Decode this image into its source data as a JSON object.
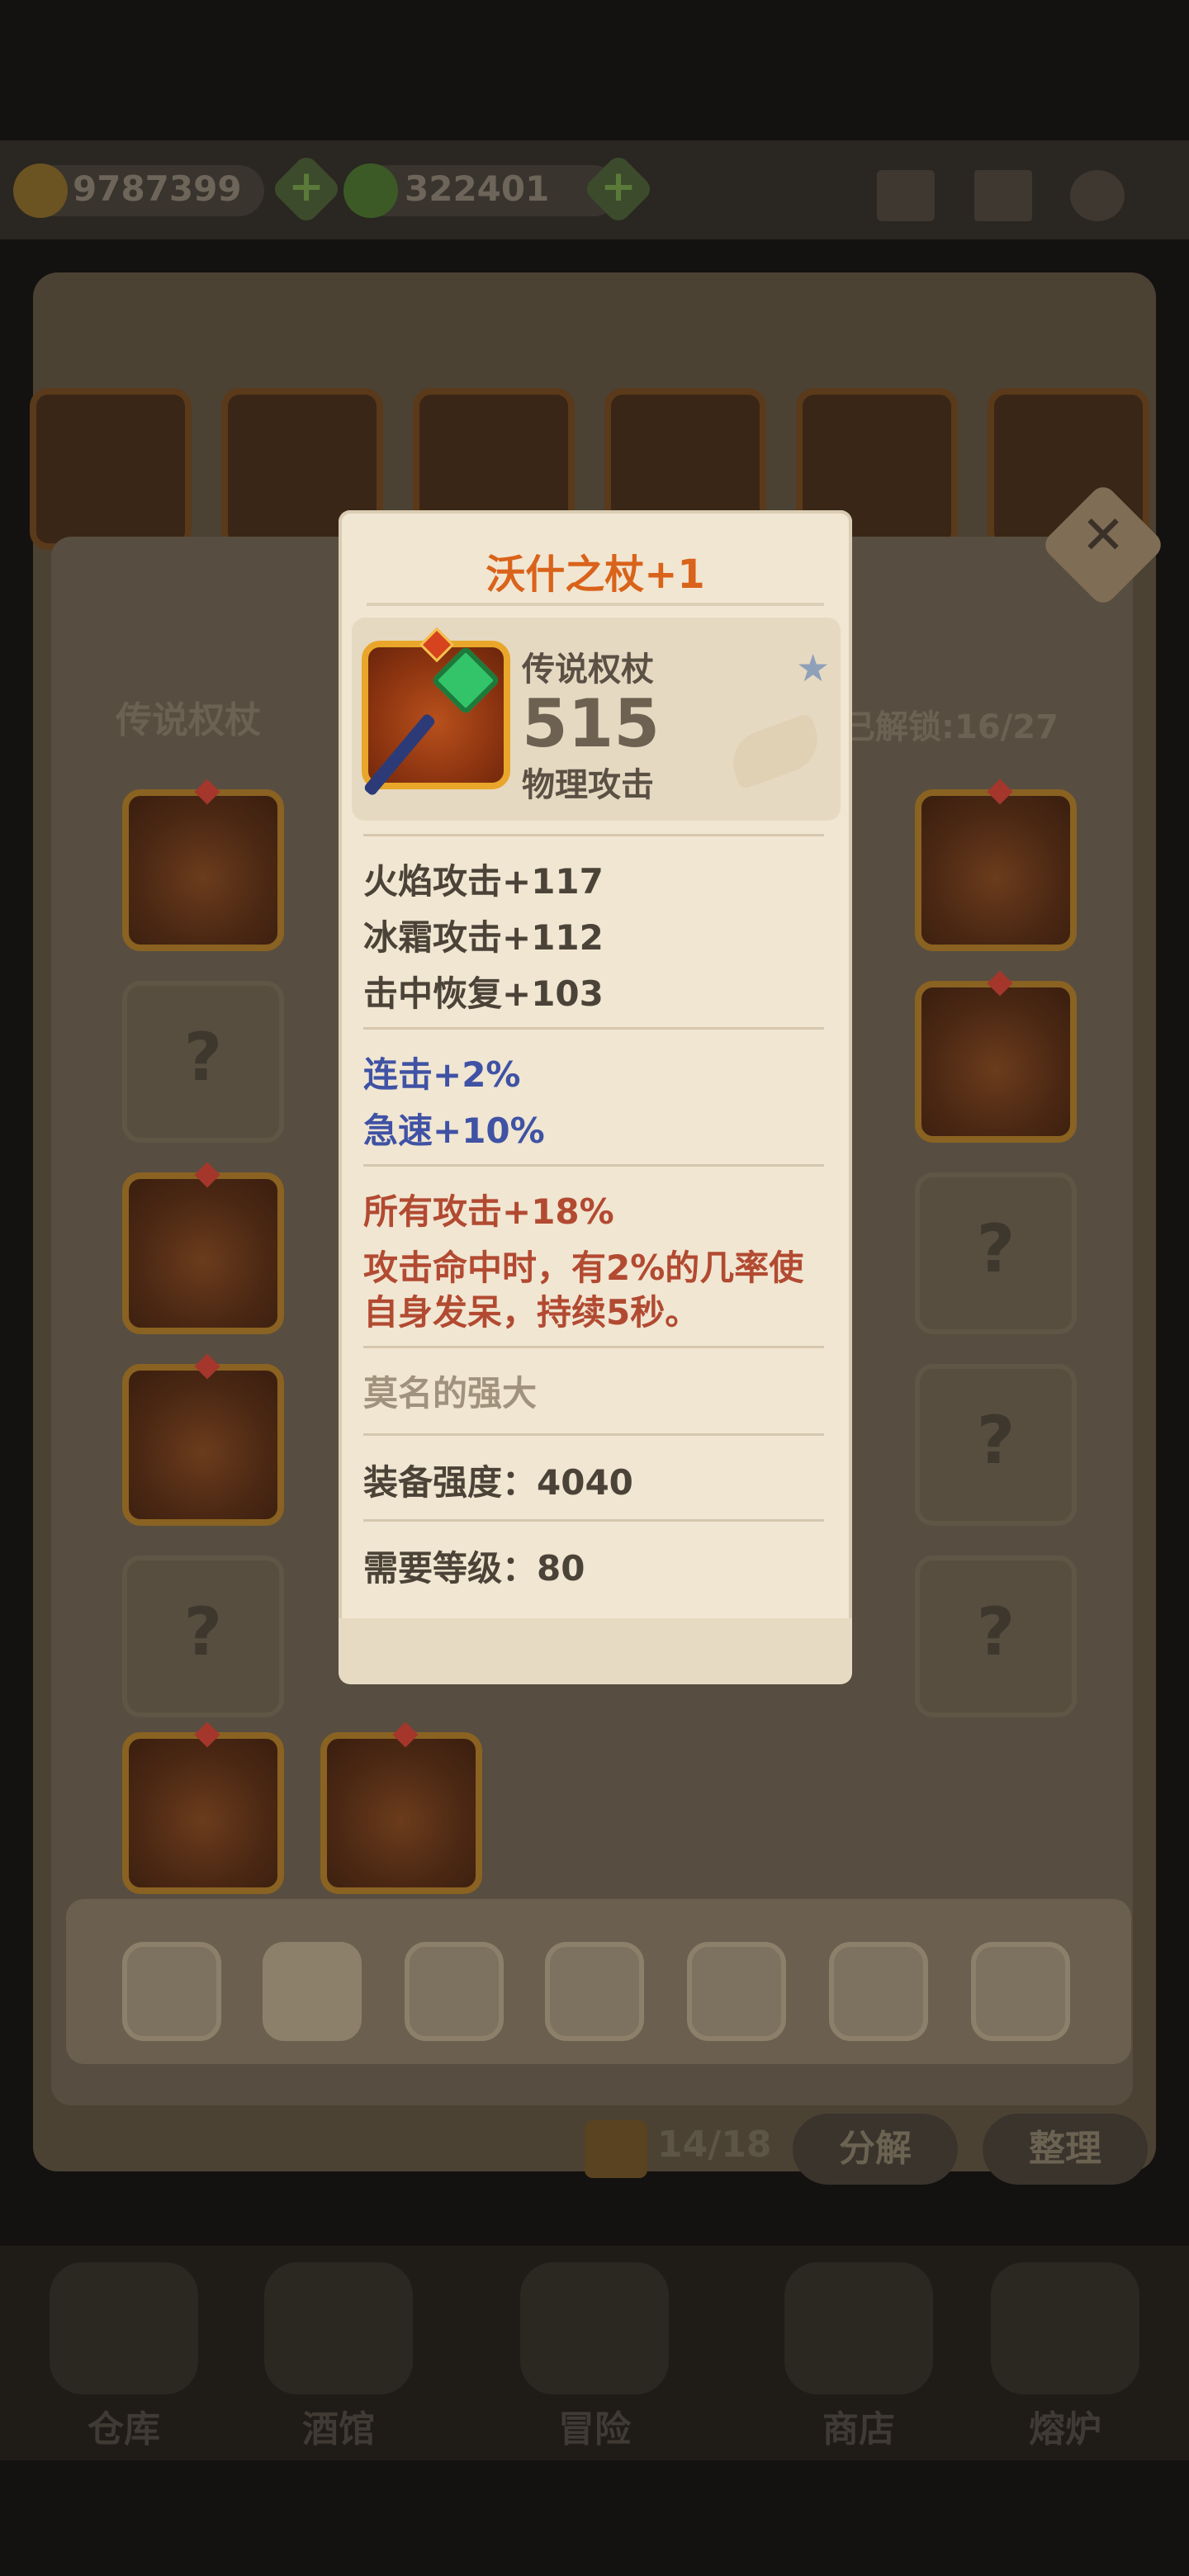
{
  "resources": {
    "gold": "9787399",
    "leaves": "322401"
  },
  "colors": {
    "legendary_name": "#d9631a",
    "blue_stat": "#3f52a4",
    "red_stat": "#b24a32",
    "muted": "#a0927c"
  },
  "panel": {
    "section_title": "传说权杖",
    "unlocked": "已解锁:16/27"
  },
  "item": {
    "name": "沃什之杖+1",
    "type": "传说权杖",
    "power": "515",
    "power_type": "物理攻击",
    "base_stats": [
      "火焰攻击+117",
      "冰霜攻击+112",
      "击中恢复+103"
    ],
    "bonus_stats": [
      "连击+2%",
      "急速+10%"
    ],
    "special": {
      "line1": "所有攻击+18%",
      "line2": "攻击命中时，有2%的几率使",
      "line3": "自身发呆，持续5秒。"
    },
    "flavor": "莫名的强大",
    "gear_strength": "装备强度：4040",
    "required_level": "需要等级：80"
  },
  "bag": {
    "count": "14/18",
    "decompose_label": "分解",
    "sort_label": "整理"
  },
  "nav": [
    "仓库",
    "酒馆",
    "冒险",
    "商店",
    "熔炉"
  ],
  "icons": {
    "close": "✕",
    "star": "★",
    "question": "?",
    "plus": "+"
  }
}
